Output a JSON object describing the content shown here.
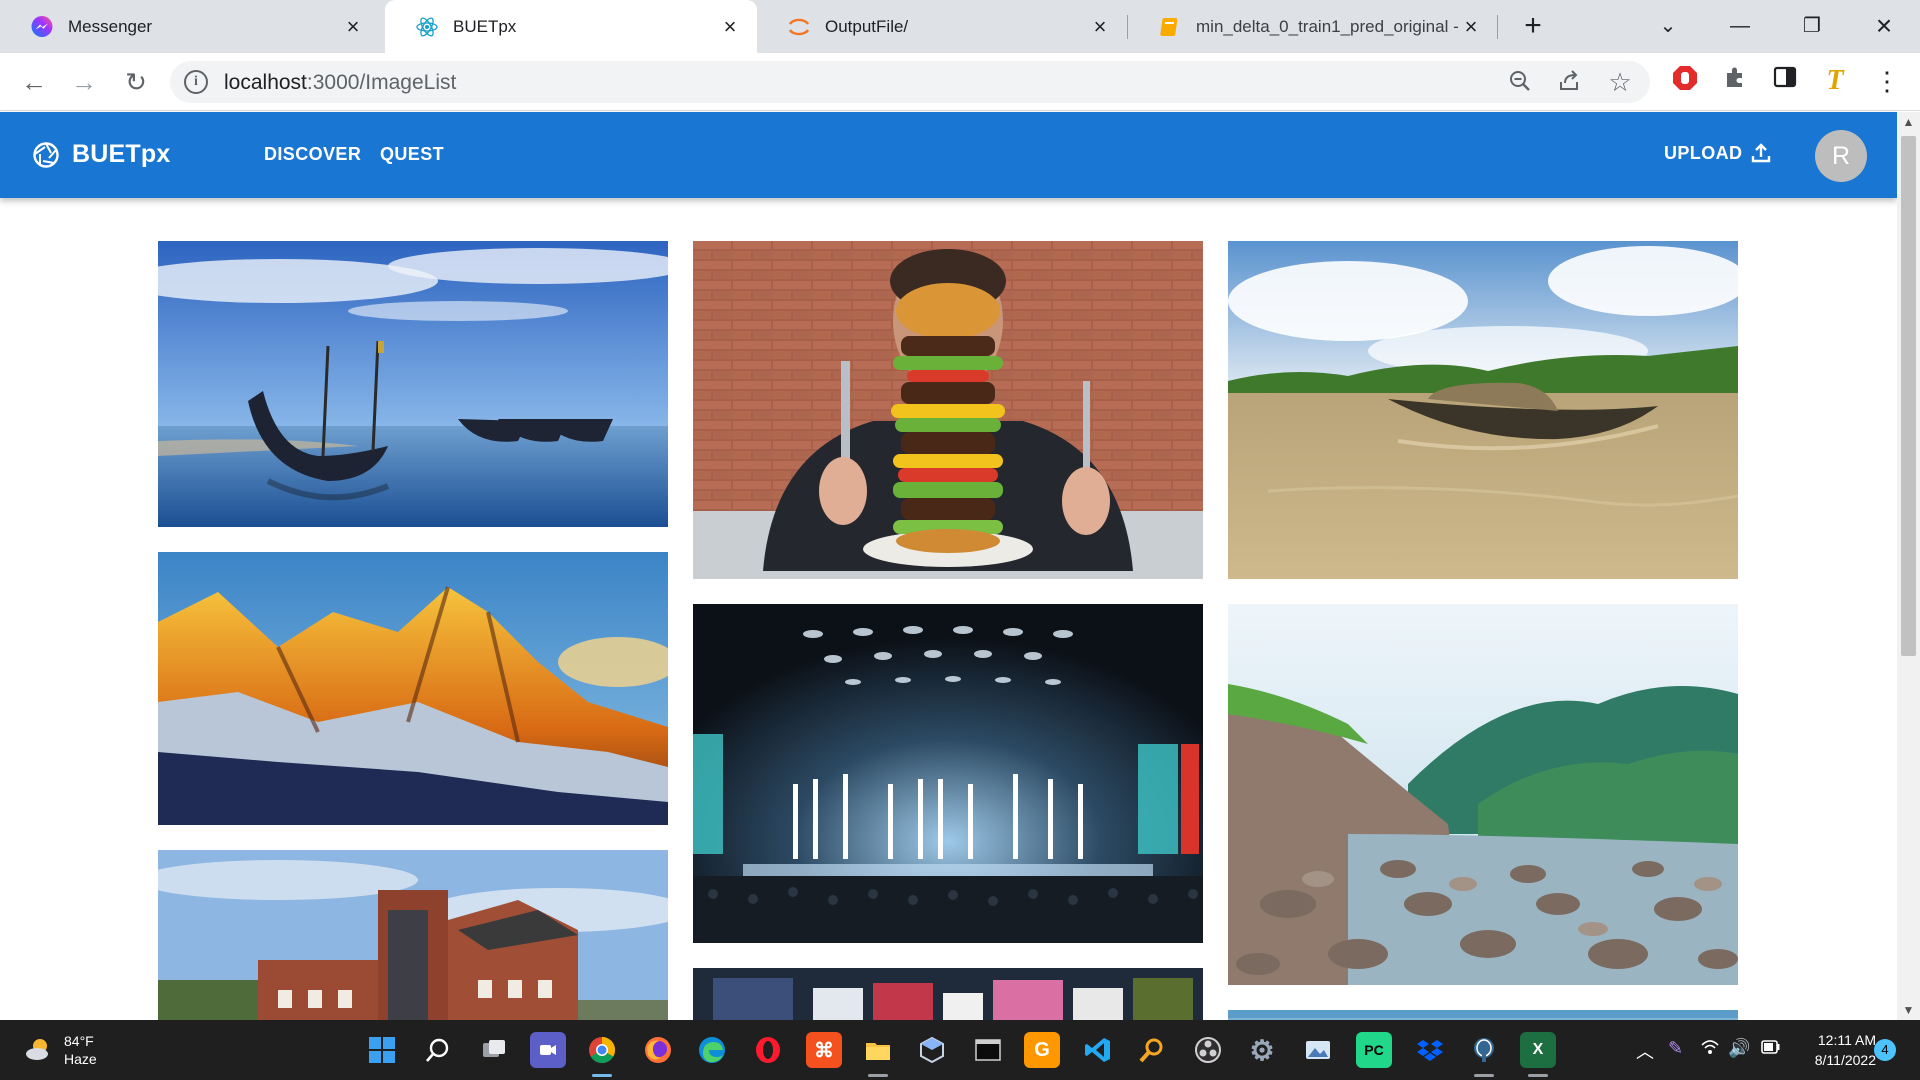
{
  "browser": {
    "tabs": [
      {
        "title": "Messenger",
        "icon": "messenger-icon"
      },
      {
        "title": "BUETpx",
        "icon": "react-icon",
        "active": true
      },
      {
        "title": "OutputFile/",
        "icon": "jupyter-icon"
      },
      {
        "title": "min_delta_0_train1_pred_original - ",
        "icon": "notebook-icon"
      }
    ],
    "new_tab_label": "+",
    "url_host": "localhost",
    "url_rest": ":3000/ImageList"
  },
  "app": {
    "brand": "BUETpx",
    "nav": [
      "DISCOVER",
      "QUEST"
    ],
    "upload_label": "UPLOAD",
    "avatar_initial": "R",
    "accent_color": "#1976d2"
  },
  "gallery": {
    "images": [
      {
        "subject": "boats-on-beach"
      },
      {
        "subject": "burger-tower"
      },
      {
        "subject": "boat-on-river"
      },
      {
        "subject": "golden-mountain"
      },
      {
        "subject": "concert-stage"
      },
      {
        "subject": "rocky-river-hills"
      },
      {
        "subject": "brick-building"
      },
      {
        "subject": "market-stall"
      },
      {
        "subject": "blue-sky"
      }
    ]
  },
  "taskbar": {
    "weather_temp": "84°F",
    "weather_desc": "Haze",
    "time": "12:11 AM",
    "date": "8/11/2022",
    "notification_count": "4"
  }
}
